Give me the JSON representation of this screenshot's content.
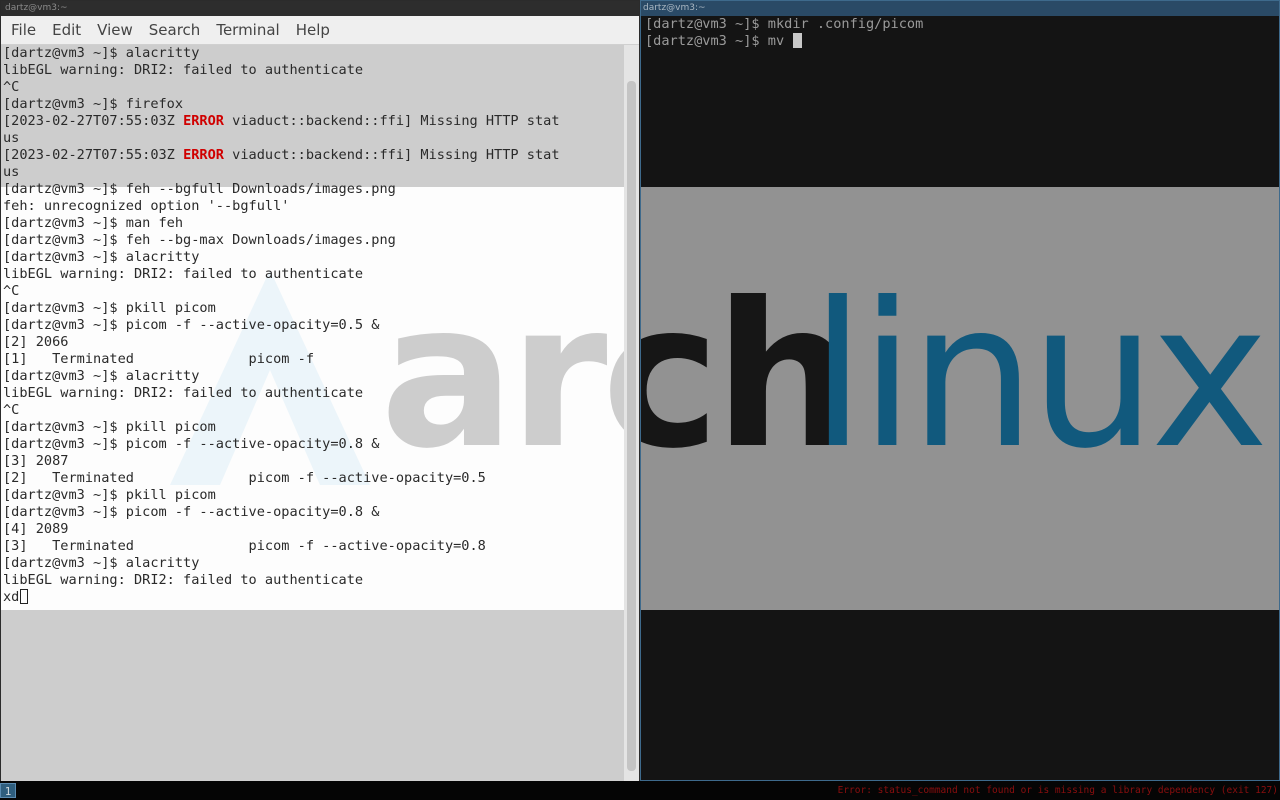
{
  "left_window": {
    "title": "dartz@vm3:~",
    "menu": [
      "File",
      "Edit",
      "View",
      "Search",
      "Terminal",
      "Help"
    ],
    "lines": [
      [
        {
          "t": "[dartz@vm3 ~]$ alacritty"
        }
      ],
      [
        {
          "t": "libEGL warning: DRI2: failed to authenticate"
        }
      ],
      [
        {
          "t": "^C"
        }
      ],
      [
        {
          "t": "[dartz@vm3 ~]$ firefox"
        }
      ],
      [
        {
          "t": "[2023-02-27T07:55:03Z "
        },
        {
          "t": "ERROR",
          "c": "err"
        },
        {
          "t": " viaduct::backend::ffi] Missing HTTP stat"
        }
      ],
      [
        {
          "t": "us"
        }
      ],
      [
        {
          "t": "[2023-02-27T07:55:03Z "
        },
        {
          "t": "ERROR",
          "c": "err"
        },
        {
          "t": " viaduct::backend::ffi] Missing HTTP stat"
        }
      ],
      [
        {
          "t": "us"
        }
      ],
      [
        {
          "t": "[dartz@vm3 ~]$ feh --bgfull Downloads/images.png"
        }
      ],
      [
        {
          "t": "feh: unrecognized option '--bgfull'"
        }
      ],
      [
        {
          "t": "[dartz@vm3 ~]$ man feh"
        }
      ],
      [
        {
          "t": "[dartz@vm3 ~]$ feh --bg-max Downloads/images.png"
        }
      ],
      [
        {
          "t": "[dartz@vm3 ~]$ alacritty"
        }
      ],
      [
        {
          "t": "libEGL warning: DRI2: failed to authenticate"
        }
      ],
      [
        {
          "t": "^C"
        }
      ],
      [
        {
          "t": "[dartz@vm3 ~]$ pkill picom"
        }
      ],
      [
        {
          "t": "[dartz@vm3 ~]$ picom -f --active-opacity=0.5 &"
        }
      ],
      [
        {
          "t": "[2] 2066"
        }
      ],
      [
        {
          "t": "[1]   Terminated              picom -f"
        }
      ],
      [
        {
          "t": "[dartz@vm3 ~]$ alacritty"
        }
      ],
      [
        {
          "t": "libEGL warning: DRI2: failed to authenticate"
        }
      ],
      [
        {
          "t": "^C"
        }
      ],
      [
        {
          "t": "[dartz@vm3 ~]$ pkill picom"
        }
      ],
      [
        {
          "t": "[dartz@vm3 ~]$ picom -f --active-opacity=0.8 &"
        }
      ],
      [
        {
          "t": "[3] 2087"
        }
      ],
      [
        {
          "t": "[2]   Terminated              picom -f --active-opacity=0.5"
        }
      ],
      [
        {
          "t": "[dartz@vm3 ~]$ pkill picom"
        }
      ],
      [
        {
          "t": "[dartz@vm3 ~]$ picom -f --active-opacity=0.8 &"
        }
      ],
      [
        {
          "t": "[4] 2089"
        }
      ],
      [
        {
          "t": "[3]   Terminated              picom -f --active-opacity=0.8"
        }
      ],
      [
        {
          "t": "[dartz@vm3 ~]$ alacritty"
        }
      ],
      [
        {
          "t": "libEGL warning: DRI2: failed to authenticate"
        }
      ],
      [
        {
          "t": "xd"
        }
      ]
    ],
    "cursor_style": "hollow-box"
  },
  "right_window": {
    "title": "dartz@vm3:~",
    "lines": [
      "[dartz@vm3 ~]$ mkdir .config/picom",
      "[dartz@vm3 ~]$ mv "
    ],
    "cursor_style": "solid-block"
  },
  "wallpaper": {
    "logo_word_dark": "arch",
    "logo_word_accent": "linux",
    "colors": {
      "band": "#f4f4f4",
      "dark": "#1f1f1f",
      "accent": "#1793d1"
    }
  },
  "statusbar": {
    "workspace": "1",
    "error_text": "Error: status_command not found or is missing a library dependency (exit 127)"
  },
  "icons": [
    "arch-logo-icon",
    "terminal-cursor-icon"
  ]
}
